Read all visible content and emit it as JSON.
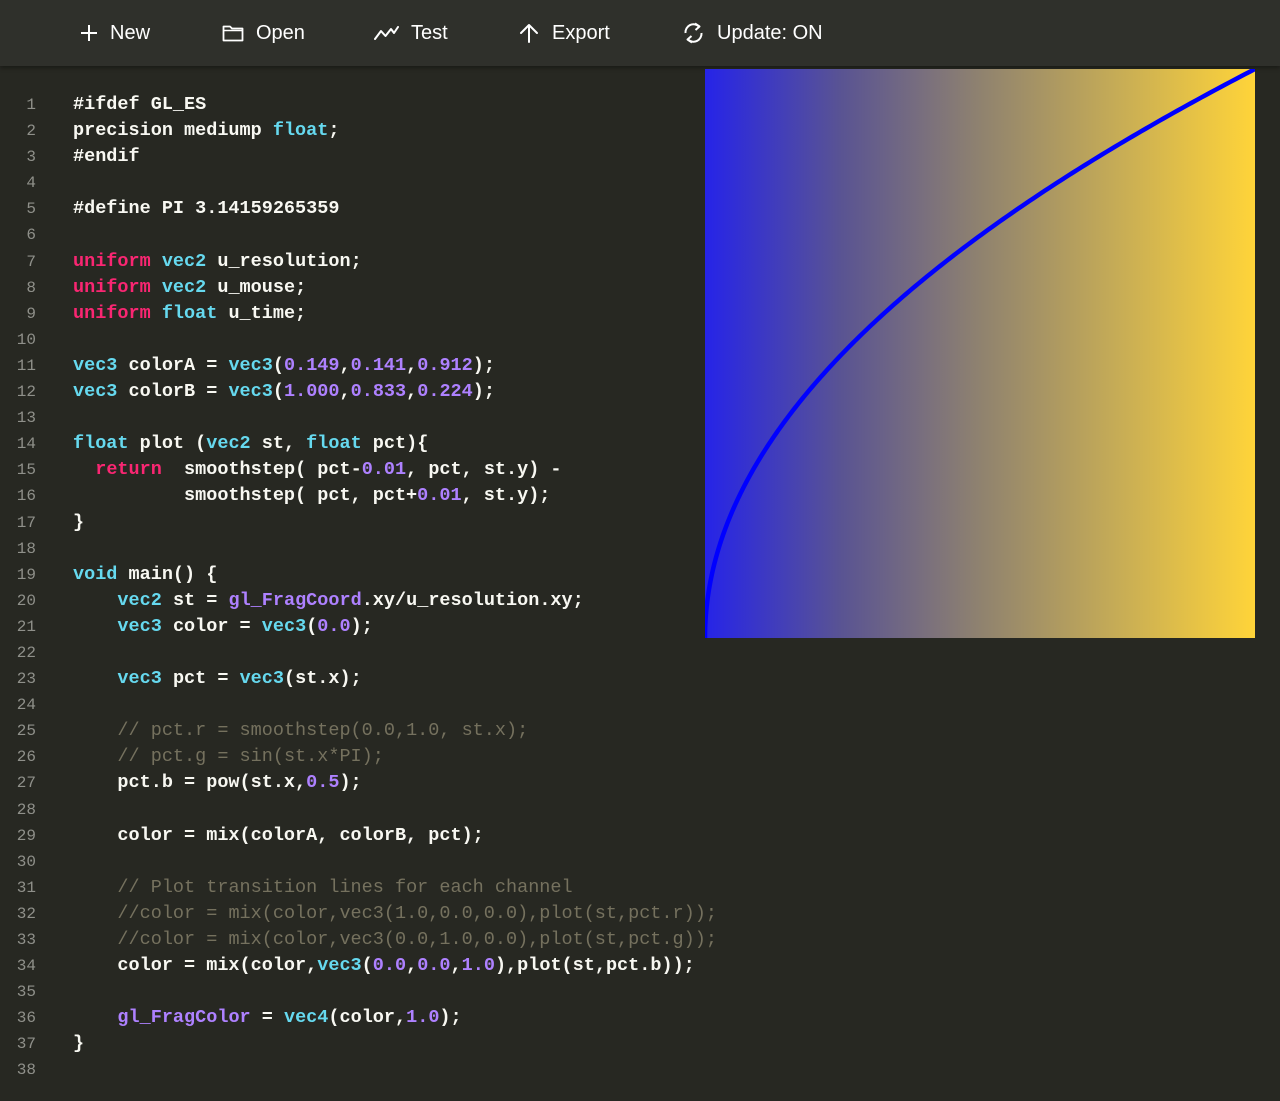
{
  "toolbar": {
    "new_label": "New",
    "open_label": "Open",
    "test_label": "Test",
    "export_label": "Export",
    "update_label": "Update: ON"
  },
  "icons": {
    "new": "plus-icon",
    "open": "folder-icon",
    "test": "trend-line-icon",
    "export": "arrow-up-icon",
    "update": "refresh-icon"
  },
  "colors": {
    "keyword": "#f92672",
    "type": "#66d9ef",
    "number": "#ae81ff",
    "comment": "#75715e",
    "text": "#f8f8f2",
    "background": "#272822",
    "toolbar": "#2f302b",
    "preview_color_a": "#2624e8",
    "preview_color_b": "#ffd439",
    "preview_plot_line": "#0000ff"
  },
  "editor": {
    "lines": [
      [
        [
          "pp",
          "#ifdef GL_ES"
        ]
      ],
      [
        [
          "t",
          "precision mediump "
        ],
        [
          "ty",
          "float"
        ],
        [
          "t",
          ";"
        ]
      ],
      [
        [
          "pp",
          "#endif"
        ]
      ],
      [],
      [
        [
          "pp",
          "#define PI 3.14159265359"
        ]
      ],
      [],
      [
        [
          "kw",
          "uniform"
        ],
        [
          "t",
          " "
        ],
        [
          "ty",
          "vec2"
        ],
        [
          "t",
          " u_resolution;"
        ]
      ],
      [
        [
          "kw",
          "uniform"
        ],
        [
          "t",
          " "
        ],
        [
          "ty",
          "vec2"
        ],
        [
          "t",
          " u_mouse;"
        ]
      ],
      [
        [
          "kw",
          "uniform"
        ],
        [
          "t",
          " "
        ],
        [
          "ty",
          "float"
        ],
        [
          "t",
          " u_time;"
        ]
      ],
      [],
      [
        [
          "ty",
          "vec3"
        ],
        [
          "t",
          " colorA = "
        ],
        [
          "ty",
          "vec3"
        ],
        [
          "t",
          "("
        ],
        [
          "num",
          "0.149"
        ],
        [
          "t",
          ","
        ],
        [
          "num",
          "0.141"
        ],
        [
          "t",
          ","
        ],
        [
          "num",
          "0.912"
        ],
        [
          "t",
          ");"
        ]
      ],
      [
        [
          "ty",
          "vec3"
        ],
        [
          "t",
          " colorB = "
        ],
        [
          "ty",
          "vec3"
        ],
        [
          "t",
          "("
        ],
        [
          "num",
          "1.000"
        ],
        [
          "t",
          ","
        ],
        [
          "num",
          "0.833"
        ],
        [
          "t",
          ","
        ],
        [
          "num",
          "0.224"
        ],
        [
          "t",
          ");"
        ]
      ],
      [],
      [
        [
          "ty",
          "float"
        ],
        [
          "t",
          " plot ("
        ],
        [
          "ty",
          "vec2"
        ],
        [
          "t",
          " st, "
        ],
        [
          "ty",
          "float"
        ],
        [
          "t",
          " pct){"
        ]
      ],
      [
        [
          "t",
          "  "
        ],
        [
          "kw",
          "return"
        ],
        [
          "t",
          "  smoothstep( pct-"
        ],
        [
          "num",
          "0.01"
        ],
        [
          "t",
          ", pct, st.y) -"
        ]
      ],
      [
        [
          "t",
          "          smoothstep( pct, pct+"
        ],
        [
          "num",
          "0.01"
        ],
        [
          "t",
          ", st.y);"
        ]
      ],
      [
        [
          "t",
          "}"
        ]
      ],
      [],
      [
        [
          "ty",
          "void"
        ],
        [
          "t",
          " main() {"
        ]
      ],
      [
        [
          "t",
          "    "
        ],
        [
          "ty",
          "vec2"
        ],
        [
          "t",
          " st = "
        ],
        [
          "bi",
          "gl_FragCoord"
        ],
        [
          "t",
          ".xy/u_resolution.xy;"
        ]
      ],
      [
        [
          "t",
          "    "
        ],
        [
          "ty",
          "vec3"
        ],
        [
          "t",
          " color = "
        ],
        [
          "ty",
          "vec3"
        ],
        [
          "t",
          "("
        ],
        [
          "num",
          "0.0"
        ],
        [
          "t",
          ");"
        ]
      ],
      [],
      [
        [
          "t",
          "    "
        ],
        [
          "ty",
          "vec3"
        ],
        [
          "t",
          " pct = "
        ],
        [
          "ty",
          "vec3"
        ],
        [
          "t",
          "(st.x);"
        ]
      ],
      [],
      [
        [
          "t",
          "    "
        ],
        [
          "cm",
          "// pct.r = smoothstep(0.0,1.0, st.x);"
        ]
      ],
      [
        [
          "t",
          "    "
        ],
        [
          "cm",
          "// pct.g = sin(st.x*PI);"
        ]
      ],
      [
        [
          "t",
          "    pct.b = pow(st.x,"
        ],
        [
          "num",
          "0.5"
        ],
        [
          "t",
          ");"
        ]
      ],
      [],
      [
        [
          "t",
          "    color = mix(colorA, colorB, pct);"
        ]
      ],
      [],
      [
        [
          "t",
          "    "
        ],
        [
          "cm",
          "// Plot transition lines for each channel"
        ]
      ],
      [
        [
          "t",
          "    "
        ],
        [
          "cm",
          "//color = mix(color,vec3(1.0,0.0,0.0),plot(st,pct.r));"
        ]
      ],
      [
        [
          "t",
          "    "
        ],
        [
          "cm",
          "//color = mix(color,vec3(0.0,1.0,0.0),plot(st,pct.g));"
        ]
      ],
      [
        [
          "t",
          "    color = mix(color,"
        ],
        [
          "ty",
          "vec3"
        ],
        [
          "t",
          "("
        ],
        [
          "num",
          "0.0"
        ],
        [
          "t",
          ","
        ],
        [
          "num",
          "0.0"
        ],
        [
          "t",
          ","
        ],
        [
          "num",
          "1.0"
        ],
        [
          "t",
          "),plot(st,pct.b));"
        ]
      ],
      [],
      [
        [
          "t",
          "    "
        ],
        [
          "bi",
          "gl_FragColor"
        ],
        [
          "t",
          " = "
        ],
        [
          "ty",
          "vec4"
        ],
        [
          "t",
          "(color,"
        ],
        [
          "num",
          "1.0"
        ],
        [
          "t",
          ");"
        ]
      ],
      [
        [
          "t",
          "}"
        ]
      ],
      []
    ]
  }
}
